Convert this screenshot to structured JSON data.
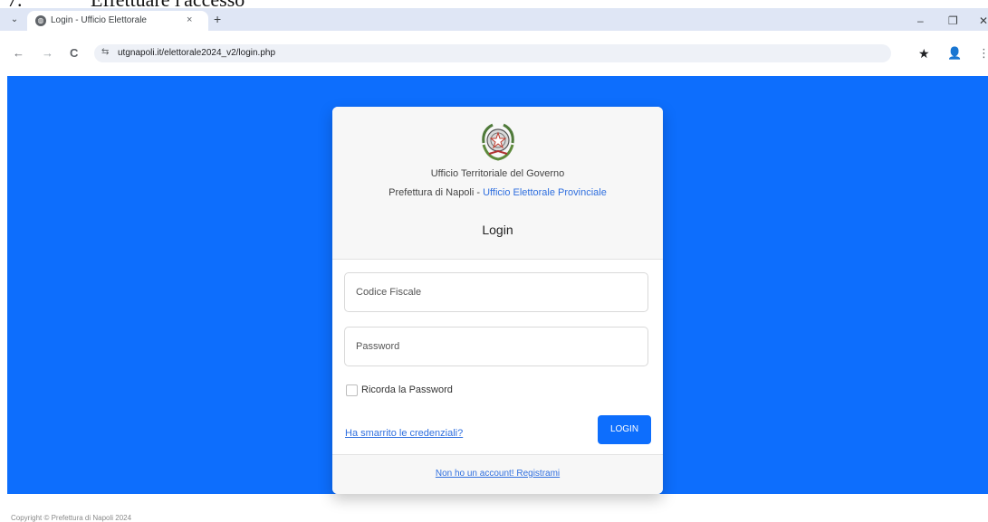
{
  "document": {
    "step_number": "7.",
    "step_text": "Effettuare l'accesso"
  },
  "browser": {
    "tab_title": "Login - Ufficio Elettorale",
    "tab_close": "×",
    "new_tab": "+",
    "tab_search": "⌄",
    "url": "utgnapoli.it/elettorale2024_v2/login.php",
    "window_minimize": "–",
    "window_restore": "❐",
    "window_close": "✕",
    "nav_back": "←",
    "nav_forward": "→",
    "nav_reload": "C",
    "bookmark": "★",
    "profile": "👤",
    "menu": "⋮",
    "site_info": "⇆"
  },
  "login_card": {
    "header_line1": "Ufficio Territoriale del Governo",
    "header_line2_prefix": "Prefettura di Napoli - ",
    "header_line2_link": "Ufficio Elettorale Provinciale",
    "title": "Login",
    "codice_fiscale_placeholder": "Codice Fiscale",
    "password_placeholder": "Password",
    "remember_label": "Ricorda la Password",
    "forgot_link": "Ha smarrito le credenziali?",
    "login_button": "LOGIN",
    "register_link": "Non ho un account! Registrami"
  },
  "footer": {
    "text": "Copyright © Prefettura di Napoli 2024"
  },
  "colors": {
    "page_background": "#0d6efd",
    "primary_button": "#0d6efd",
    "link": "#2f6fdf"
  }
}
